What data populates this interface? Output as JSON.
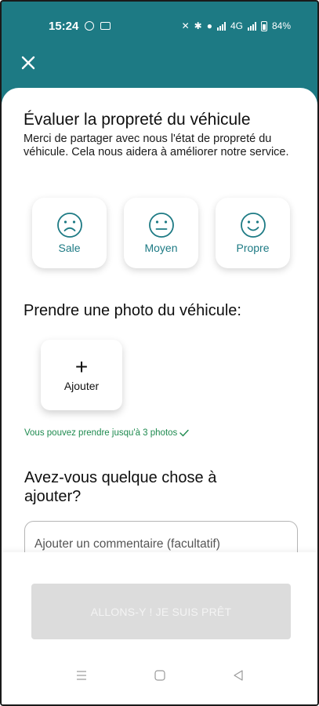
{
  "status_bar": {
    "time": "15:24",
    "battery": "84%",
    "network": "4G"
  },
  "header": {
    "close_icon": "close-icon"
  },
  "rating": {
    "title": "Évaluer la propreté du véhicule",
    "subtitle": "Merci de partager avec nous l'état de propreté du véhicule. Cela nous aidera à améliorer notre service.",
    "options": [
      {
        "label": "Sale",
        "icon": "sad-face-icon"
      },
      {
        "label": "Moyen",
        "icon": "neutral-face-icon"
      },
      {
        "label": "Propre",
        "icon": "happy-face-icon"
      }
    ]
  },
  "photo": {
    "title": "Prendre une photo du véhicule:",
    "add_label": "Ajouter",
    "plus": "+",
    "hint": "Vous pouvez prendre jusqu'à 3 photos"
  },
  "comment": {
    "title": "Avez-vous quelque chose à ajouter?",
    "placeholder": "Ajouter un commentaire (facultatif)"
  },
  "cta": {
    "label": "ALLONS-Y ! JE SUIS PRÊT"
  },
  "colors": {
    "accent": "#1d7a84",
    "success": "#1e8a4f",
    "disabled_button": "#dcdcdc"
  }
}
